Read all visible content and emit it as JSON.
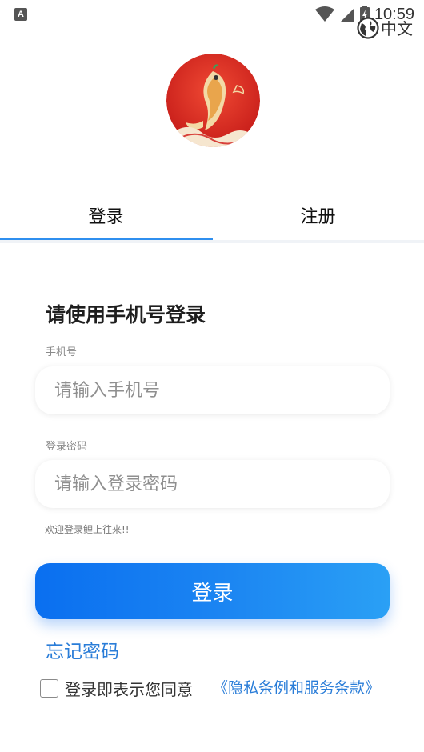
{
  "status_bar": {
    "app_icon_letter": "A",
    "time": "10:59"
  },
  "language_switch": {
    "label": "中文",
    "icon": "globe-icon"
  },
  "logo": {
    "icon": "koi-fish-logo"
  },
  "tabs": [
    {
      "label": "登录",
      "active": true
    },
    {
      "label": "注册",
      "active": false
    }
  ],
  "form": {
    "title": "请使用手机号登录",
    "phone_label": "手机号",
    "phone_placeholder": "请输入手机号",
    "password_label": "登录密码",
    "password_placeholder": "请输入登录密码",
    "welcome_text": "欢迎登录鲤上往来!!",
    "login_button": "登录",
    "forgot_password": "忘记密码",
    "agree_text": "登录即表示您同意",
    "privacy_link": "《隐私条例和服务条款》"
  },
  "colors": {
    "accent": "#2f8fef",
    "link": "#2a7dd8",
    "button_gradient_start": "#0a6ff0",
    "button_gradient_end": "#2aa0f5",
    "logo_red": "#d92a23"
  }
}
